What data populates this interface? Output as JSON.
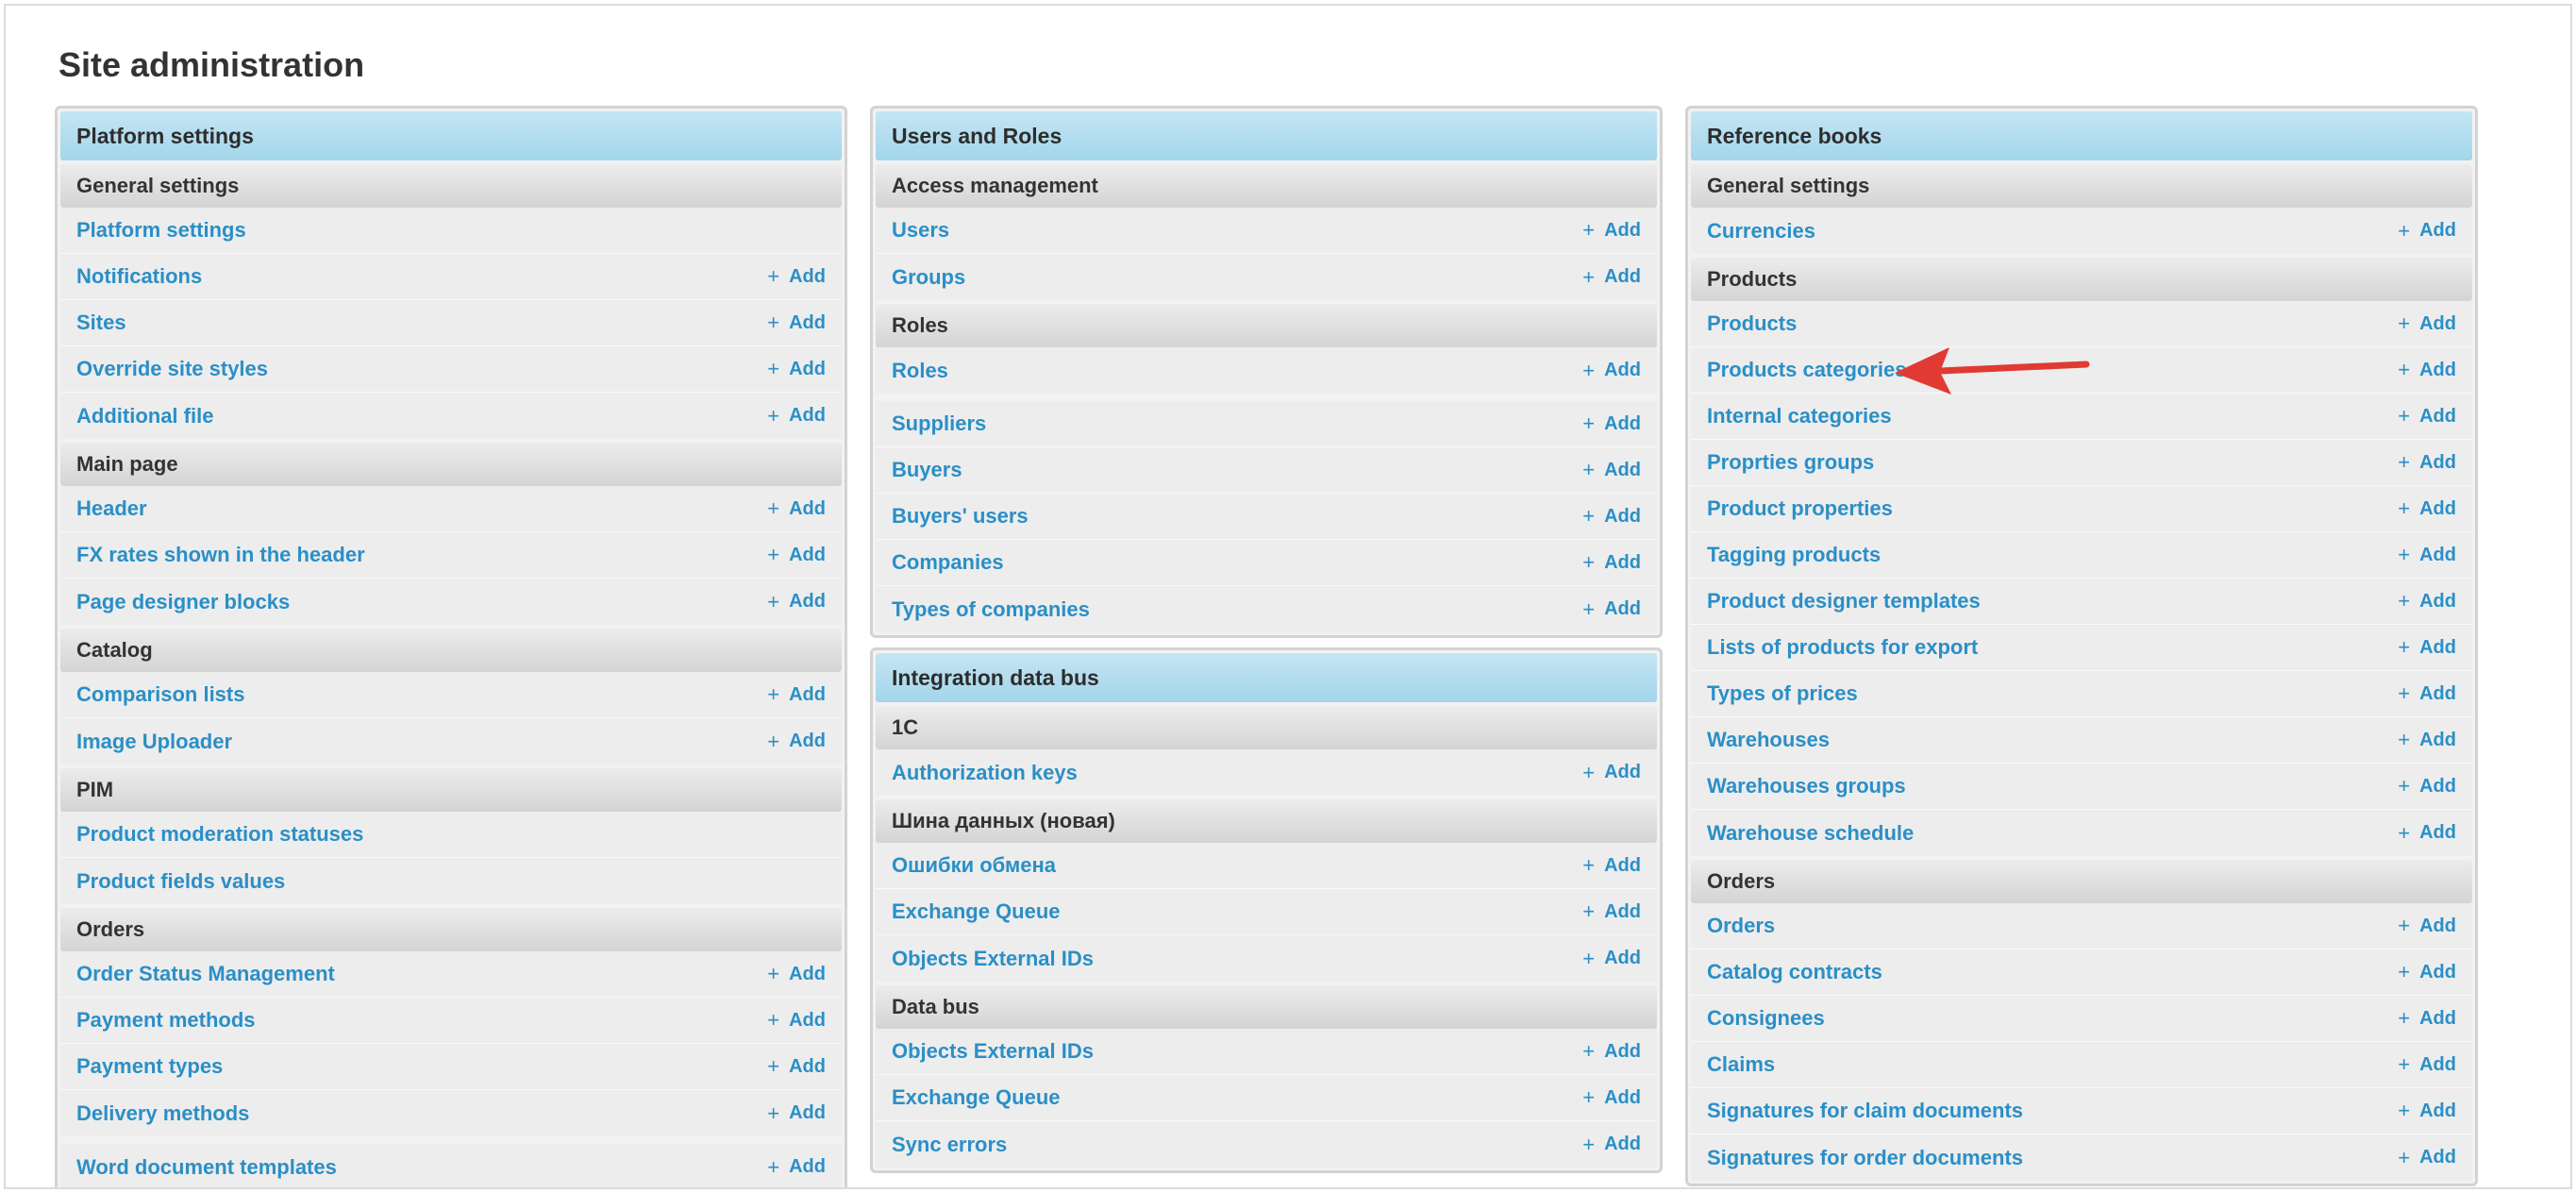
{
  "page_title": "Site administration",
  "add_label": "Add",
  "columns": [
    {
      "modules": [
        {
          "caption": "Platform settings",
          "groups": [
            {
              "title": "General settings",
              "items": [
                {
                  "label": "Platform settings",
                  "add": false
                },
                {
                  "label": "Notifications",
                  "add": true
                },
                {
                  "label": "Sites",
                  "add": true
                },
                {
                  "label": "Override site styles",
                  "add": true
                },
                {
                  "label": "Additional file",
                  "add": true
                }
              ]
            },
            {
              "title": "Main page",
              "items": [
                {
                  "label": "Header",
                  "add": true
                },
                {
                  "label": "FX rates shown in the header",
                  "add": true
                },
                {
                  "label": "Page designer blocks",
                  "add": true
                }
              ]
            },
            {
              "title": "Catalog",
              "items": [
                {
                  "label": "Comparison lists",
                  "add": true
                },
                {
                  "label": "Image Uploader",
                  "add": true
                }
              ]
            },
            {
              "title": "PIM",
              "items": [
                {
                  "label": "Product moderation statuses",
                  "add": false
                },
                {
                  "label": "Product fields values",
                  "add": false
                }
              ]
            },
            {
              "title": "Orders",
              "items": [
                {
                  "label": "Order Status Management",
                  "add": true
                },
                {
                  "label": "Payment methods",
                  "add": true
                },
                {
                  "label": "Payment types",
                  "add": true
                },
                {
                  "label": "Delivery methods",
                  "add": true
                }
              ]
            },
            {
              "title": "",
              "items": [
                {
                  "label": "Word document templates",
                  "add": true
                }
              ]
            }
          ]
        }
      ]
    },
    {
      "modules": [
        {
          "caption": "Users and Roles",
          "groups": [
            {
              "title": "Access management",
              "items": [
                {
                  "label": "Users",
                  "add": true
                },
                {
                  "label": "Groups",
                  "add": true
                }
              ]
            },
            {
              "title": "Roles",
              "items": [
                {
                  "label": "Roles",
                  "add": true
                }
              ]
            },
            {
              "title": "",
              "items": [
                {
                  "label": "Suppliers",
                  "add": true
                },
                {
                  "label": "Buyers",
                  "add": true
                },
                {
                  "label": "Buyers' users",
                  "add": true
                },
                {
                  "label": "Companies",
                  "add": true
                },
                {
                  "label": "Types of companies",
                  "add": true
                }
              ]
            }
          ]
        },
        {
          "caption": "Integration data bus",
          "groups": [
            {
              "title": "1C",
              "items": [
                {
                  "label": "Authorization keys",
                  "add": true
                }
              ]
            },
            {
              "title": "Шина данных (новая)",
              "items": [
                {
                  "label": "Ошибки обмена",
                  "add": true
                },
                {
                  "label": "Exchange Queue",
                  "add": true
                },
                {
                  "label": "Objects External IDs",
                  "add": true
                }
              ]
            },
            {
              "title": "Data bus",
              "items": [
                {
                  "label": "Objects External IDs",
                  "add": true
                },
                {
                  "label": "Exchange Queue",
                  "add": true
                },
                {
                  "label": "Sync errors",
                  "add": true
                }
              ]
            }
          ]
        }
      ]
    },
    {
      "modules": [
        {
          "caption": "Reference books",
          "groups": [
            {
              "title": "General settings",
              "items": [
                {
                  "label": "Currencies",
                  "add": true
                }
              ]
            },
            {
              "title": "Products",
              "items": [
                {
                  "label": "Products",
                  "add": true
                },
                {
                  "label": "Products categories",
                  "add": true
                },
                {
                  "label": "Internal categories",
                  "add": true
                },
                {
                  "label": "Proprties groups",
                  "add": true
                },
                {
                  "label": "Product properties",
                  "add": true
                },
                {
                  "label": "Tagging products",
                  "add": true
                },
                {
                  "label": "Product designer templates",
                  "add": true
                },
                {
                  "label": "Lists of products for export",
                  "add": true
                },
                {
                  "label": "Types of prices",
                  "add": true
                },
                {
                  "label": "Warehouses",
                  "add": true
                },
                {
                  "label": "Warehouses groups",
                  "add": true
                },
                {
                  "label": "Warehouse schedule",
                  "add": true
                }
              ]
            },
            {
              "title": "Orders",
              "items": [
                {
                  "label": "Orders",
                  "add": true
                },
                {
                  "label": "Catalog contracts",
                  "add": true
                },
                {
                  "label": "Consignees",
                  "add": true
                },
                {
                  "label": "Claims",
                  "add": true
                },
                {
                  "label": "Signatures for claim documents",
                  "add": true
                },
                {
                  "label": "Signatures for order documents",
                  "add": true
                }
              ]
            }
          ]
        }
      ]
    }
  ],
  "annotation_color": "#e03a33",
  "link_color": "#2a8fc7"
}
